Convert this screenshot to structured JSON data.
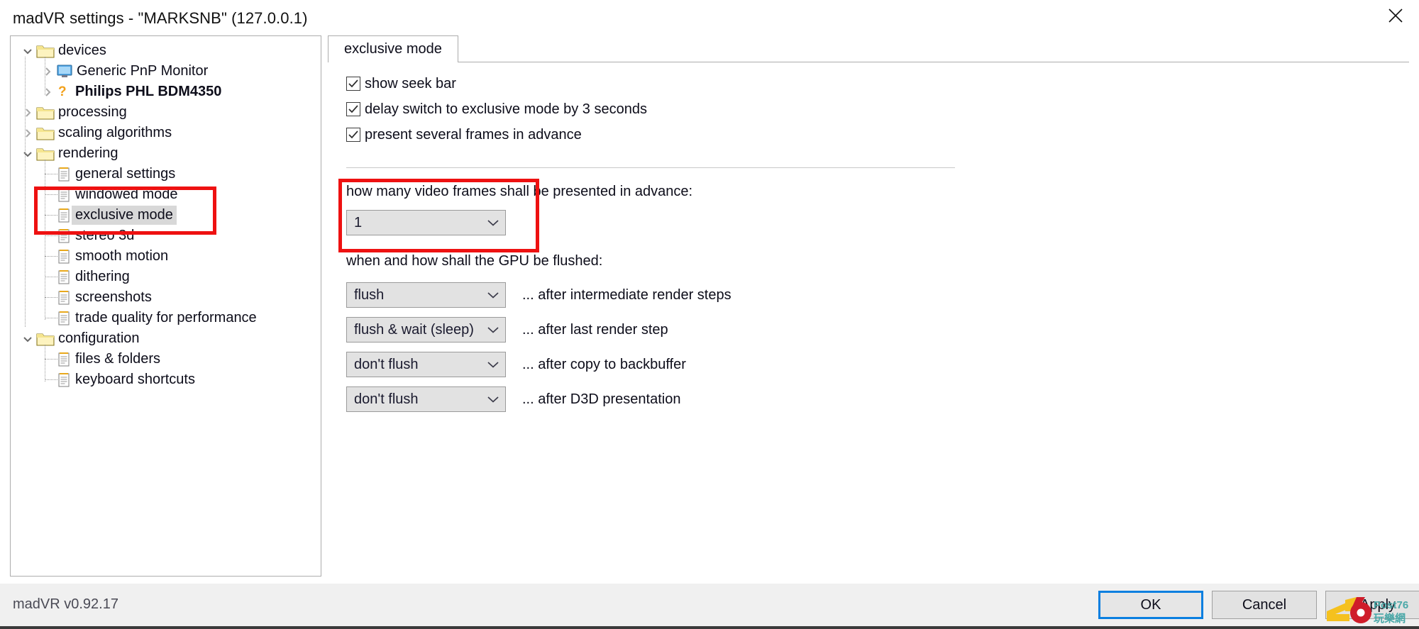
{
  "window": {
    "title": "madVR settings - \"MARKSNB\" (127.0.0.1)",
    "close_icon": "close-icon"
  },
  "tree": {
    "items": [
      {
        "label": "devices",
        "level": 0,
        "icon": "folder-icon",
        "expander": "chevron-down-icon",
        "selected": false,
        "bold": false
      },
      {
        "label": "Generic PnP Monitor",
        "level": 1,
        "icon": "monitor-icon",
        "expander": "chevron-right-icon",
        "selected": false,
        "bold": false
      },
      {
        "label": "Philips PHL BDM4350",
        "level": 1,
        "icon": "question-icon",
        "expander": "chevron-right-icon",
        "selected": false,
        "bold": true
      },
      {
        "label": "processing",
        "level": 0,
        "icon": "folder-icon",
        "expander": "chevron-right-icon",
        "selected": false,
        "bold": false
      },
      {
        "label": "scaling algorithms",
        "level": 0,
        "icon": "folder-icon",
        "expander": "chevron-right-icon",
        "selected": false,
        "bold": false
      },
      {
        "label": "rendering",
        "level": 0,
        "icon": "folder-icon",
        "expander": "chevron-down-icon",
        "selected": false,
        "bold": false
      },
      {
        "label": "general settings",
        "level": 1,
        "icon": "page-icon",
        "expander": "none",
        "selected": false,
        "bold": false
      },
      {
        "label": "windowed mode",
        "level": 1,
        "icon": "page-icon",
        "expander": "none",
        "selected": false,
        "bold": false
      },
      {
        "label": "exclusive mode",
        "level": 1,
        "icon": "page-icon",
        "expander": "none",
        "selected": true,
        "bold": false
      },
      {
        "label": "stereo 3d",
        "level": 1,
        "icon": "page-icon",
        "expander": "none",
        "selected": false,
        "bold": false
      },
      {
        "label": "smooth motion",
        "level": 1,
        "icon": "page-icon",
        "expander": "none",
        "selected": false,
        "bold": false
      },
      {
        "label": "dithering",
        "level": 1,
        "icon": "page-icon",
        "expander": "none",
        "selected": false,
        "bold": false
      },
      {
        "label": "screenshots",
        "level": 1,
        "icon": "page-icon",
        "expander": "none",
        "selected": false,
        "bold": false
      },
      {
        "label": "trade quality for performance",
        "level": 1,
        "icon": "page-icon",
        "expander": "none",
        "selected": false,
        "bold": false
      },
      {
        "label": "configuration",
        "level": 0,
        "icon": "folder-icon",
        "expander": "chevron-down-icon",
        "selected": false,
        "bold": false
      },
      {
        "label": "files & folders",
        "level": 1,
        "icon": "page-icon",
        "expander": "none",
        "selected": false,
        "bold": false
      },
      {
        "label": "keyboard shortcuts",
        "level": 1,
        "icon": "page-icon",
        "expander": "none",
        "selected": false,
        "bold": false
      }
    ]
  },
  "content": {
    "tab_label": "exclusive mode",
    "checkboxes": [
      {
        "label": "show seek bar",
        "checked": true
      },
      {
        "label": "delay switch to exclusive mode by 3 seconds",
        "checked": true
      },
      {
        "label": "present several frames in advance",
        "checked": true
      }
    ],
    "frames_section": {
      "label": "how many video frames shall be presented in advance:",
      "value": "1",
      "arrow_icon": "chevron-down-icon"
    },
    "gpu_section": {
      "label": "when and how shall the GPU be flushed:",
      "rows": [
        {
          "value": "flush",
          "description": "... after intermediate render steps",
          "arrow_icon": "chevron-down-icon"
        },
        {
          "value": "flush & wait (sleep)",
          "description": "... after last render step",
          "arrow_icon": "chevron-down-icon"
        },
        {
          "value": "don't flush",
          "description": "... after copy to backbuffer",
          "arrow_icon": "chevron-down-icon"
        },
        {
          "value": "don't flush",
          "description": "... after D3D presentation",
          "arrow_icon": "chevron-down-icon"
        }
      ]
    }
  },
  "annotations": {
    "highlight_color": "#ee1111",
    "boxes": [
      {
        "name": "tree-highlight-box"
      },
      {
        "name": "frames-dropdown-highlight-box"
      }
    ]
  },
  "footer": {
    "version": "madVR v0.92.17",
    "buttons": [
      {
        "label": "OK",
        "default": true
      },
      {
        "label": "Cancel",
        "default": false
      },
      {
        "label": "Apply",
        "default": false
      }
    ]
  },
  "watermark": {
    "number": "76",
    "brand": "Post76",
    "subtitle": "玩樂網",
    "colors": {
      "yellow": "#f5c11e",
      "red": "#cf1c2a",
      "teal": "#4aa8a8"
    }
  }
}
